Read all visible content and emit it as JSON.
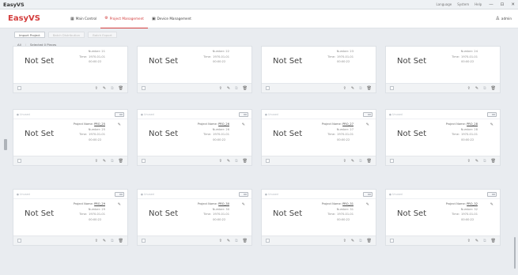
{
  "window": {
    "title": "EasyVS",
    "menu": [
      "Language",
      "System",
      "Help"
    ],
    "controls": [
      "—",
      "⊡",
      "✕"
    ]
  },
  "nav": {
    "logo": "EasyVS",
    "tabs": [
      {
        "label": "Main Control",
        "icon": "grid-icon",
        "active": false
      },
      {
        "label": "Project Management",
        "icon": "gear-icon",
        "active": true
      },
      {
        "label": "Device Management",
        "icon": "device-icon",
        "active": false
      }
    ],
    "user": "admin"
  },
  "toolbar": {
    "import_label": "Import Project",
    "batch_label": "Batch Distribution",
    "batch2_label": "Batch Export"
  },
  "filter": {
    "all_label": "All",
    "selected_label": "Selected 0 Pieces"
  },
  "labels": {
    "not_set": "Not Set",
    "status": "● Unused",
    "number_prefix": "Number:",
    "project_prefix": "Project Name:",
    "time_prefix": "Time:"
  },
  "cards": [
    {
      "number": "21",
      "project": "",
      "time_date": "1970-01-01",
      "time_clock": "00:00:22",
      "has_head": false,
      "has_project": false
    },
    {
      "number": "22",
      "project": "",
      "time_date": "1970-01-01",
      "time_clock": "00:00:22",
      "has_head": false,
      "has_project": false
    },
    {
      "number": "23",
      "project": "",
      "time_date": "1970-01-01",
      "time_clock": "00:00:22",
      "has_head": false,
      "has_project": false
    },
    {
      "number": "24",
      "project": "",
      "time_date": "1970-01-01",
      "time_clock": "00:00:22",
      "has_head": false,
      "has_project": false
    },
    {
      "number": "25",
      "project": "PRO_25",
      "time_date": "1970-01-01",
      "time_clock": "00:00:22",
      "has_head": true,
      "has_project": true
    },
    {
      "number": "26",
      "project": "PRO_26",
      "time_date": "1970-01-01",
      "time_clock": "00:00:22",
      "has_head": true,
      "has_project": true
    },
    {
      "number": "27",
      "project": "PRO_27",
      "time_date": "1970-01-01",
      "time_clock": "00:00:22",
      "has_head": true,
      "has_project": true
    },
    {
      "number": "28",
      "project": "PRO_28",
      "time_date": "1970-01-01",
      "time_clock": "00:00:22",
      "has_head": true,
      "has_project": true
    },
    {
      "number": "29",
      "project": "PRO_29",
      "time_date": "1970-01-01",
      "time_clock": "00:00:22",
      "has_head": true,
      "has_project": true
    },
    {
      "number": "30",
      "project": "PRO_30",
      "time_date": "1970-01-01",
      "time_clock": "00:00:22",
      "has_head": true,
      "has_project": true
    },
    {
      "number": "31",
      "project": "PRO_31",
      "time_date": "1970-01-01",
      "time_clock": "00:00:22",
      "has_head": true,
      "has_project": true
    },
    {
      "number": "32",
      "project": "PRO_32",
      "time_date": "1970-01-01",
      "time_clock": "00:00:22",
      "has_head": true,
      "has_project": true
    }
  ]
}
